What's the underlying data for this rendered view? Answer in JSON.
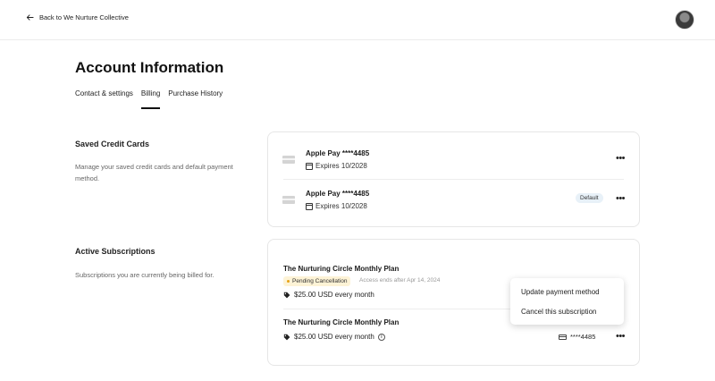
{
  "header": {
    "back_label": "Back to We Nurture Collective"
  },
  "page": {
    "title": "Account Information"
  },
  "tabs": [
    {
      "label": "Contact & settings",
      "active": false
    },
    {
      "label": "Billing",
      "active": true
    },
    {
      "label": "Purchase History",
      "active": false
    }
  ],
  "credit_cards": {
    "title": "Saved Credit Cards",
    "description": "Manage your saved credit cards and default payment method.",
    "cards": [
      {
        "name": "Apple Pay ****4485",
        "expires": "Expires 10/2028",
        "default_label": ""
      },
      {
        "name": "Apple Pay ****4485",
        "expires": "Expires 10/2028",
        "default_label": "Default"
      }
    ]
  },
  "subscriptions": {
    "title": "Active Subscriptions",
    "description": "Subscriptions you are currently being billed for.",
    "items": [
      {
        "name": "The Nurturing Circle Monthly Plan",
        "status": "Pending Cancellation",
        "status_color": "#e8a317",
        "access_note": "Access ends after Apr 14, 2024",
        "price": "$25.00 USD every month"
      },
      {
        "name": "The Nurturing Circle Monthly Plan",
        "price": "$25.00 USD every month",
        "card_last4": "****4485"
      }
    ]
  },
  "dropdown_menu": {
    "items": [
      "Update payment method",
      "Cancel this subscription"
    ]
  }
}
